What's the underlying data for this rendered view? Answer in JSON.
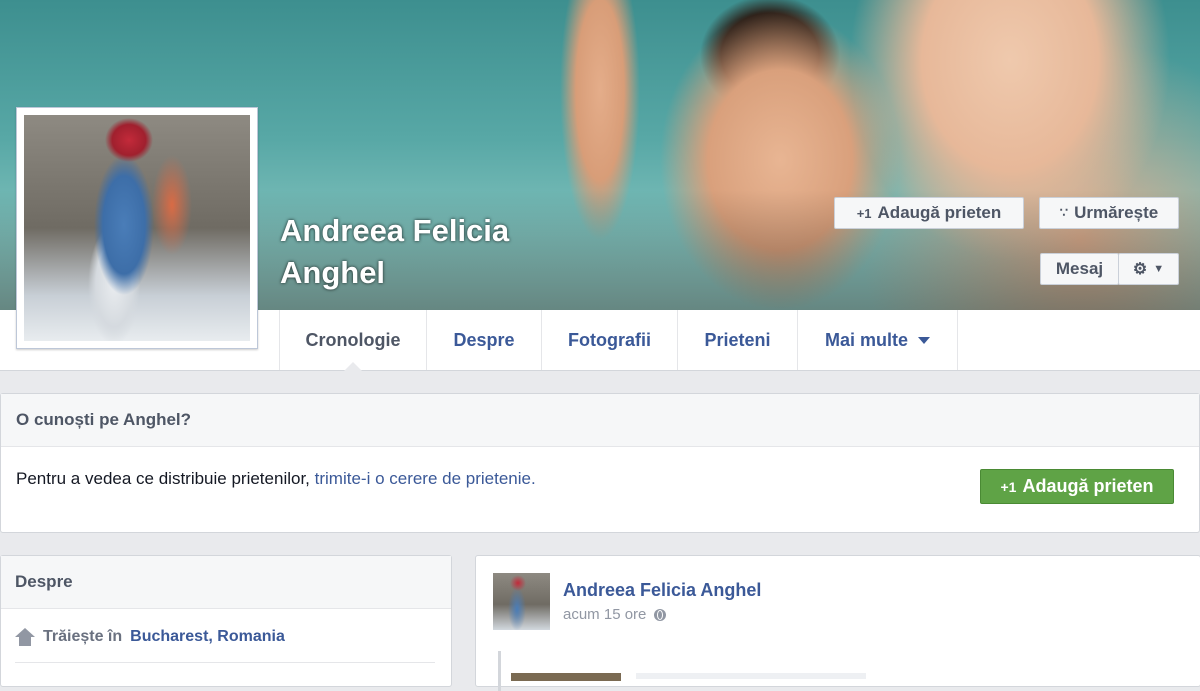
{
  "profile": {
    "name": "Andreea Felicia Anghel",
    "name_line1": "Andreea Felicia",
    "name_line2": "Anghel"
  },
  "actions": {
    "add_friend": "Adaugă prieten",
    "add_friend_icon": "+1",
    "follow": "Urmărește",
    "follow_icon": "rss-icon",
    "message": "Mesaj",
    "settings_icon": "gear-icon"
  },
  "tabs": [
    {
      "label": "Cronologie",
      "active": true
    },
    {
      "label": "Despre"
    },
    {
      "label": "Fotografii"
    },
    {
      "label": "Prieteni"
    },
    {
      "label": "Mai multe"
    }
  ],
  "know_box": {
    "heading": "O cunoști pe Anghel?",
    "text": "Pentru a vedea ce distribuie prietenilor, ",
    "link": "trimite-i o cerere de prietenie.",
    "button": "Adaugă prieten",
    "button_icon": "+1"
  },
  "about": {
    "heading": "Despre",
    "lives_in_label": "Trăiește în",
    "lives_in_place": "Bucharest, Romania"
  },
  "post": {
    "author": "Andreea Felicia Anghel",
    "time": "acum 15 ore",
    "privacy_icon": "globe-icon"
  },
  "colors": {
    "link_blue": "#3b5998",
    "green_button": "#5fa346",
    "background": "#e9eaed"
  }
}
